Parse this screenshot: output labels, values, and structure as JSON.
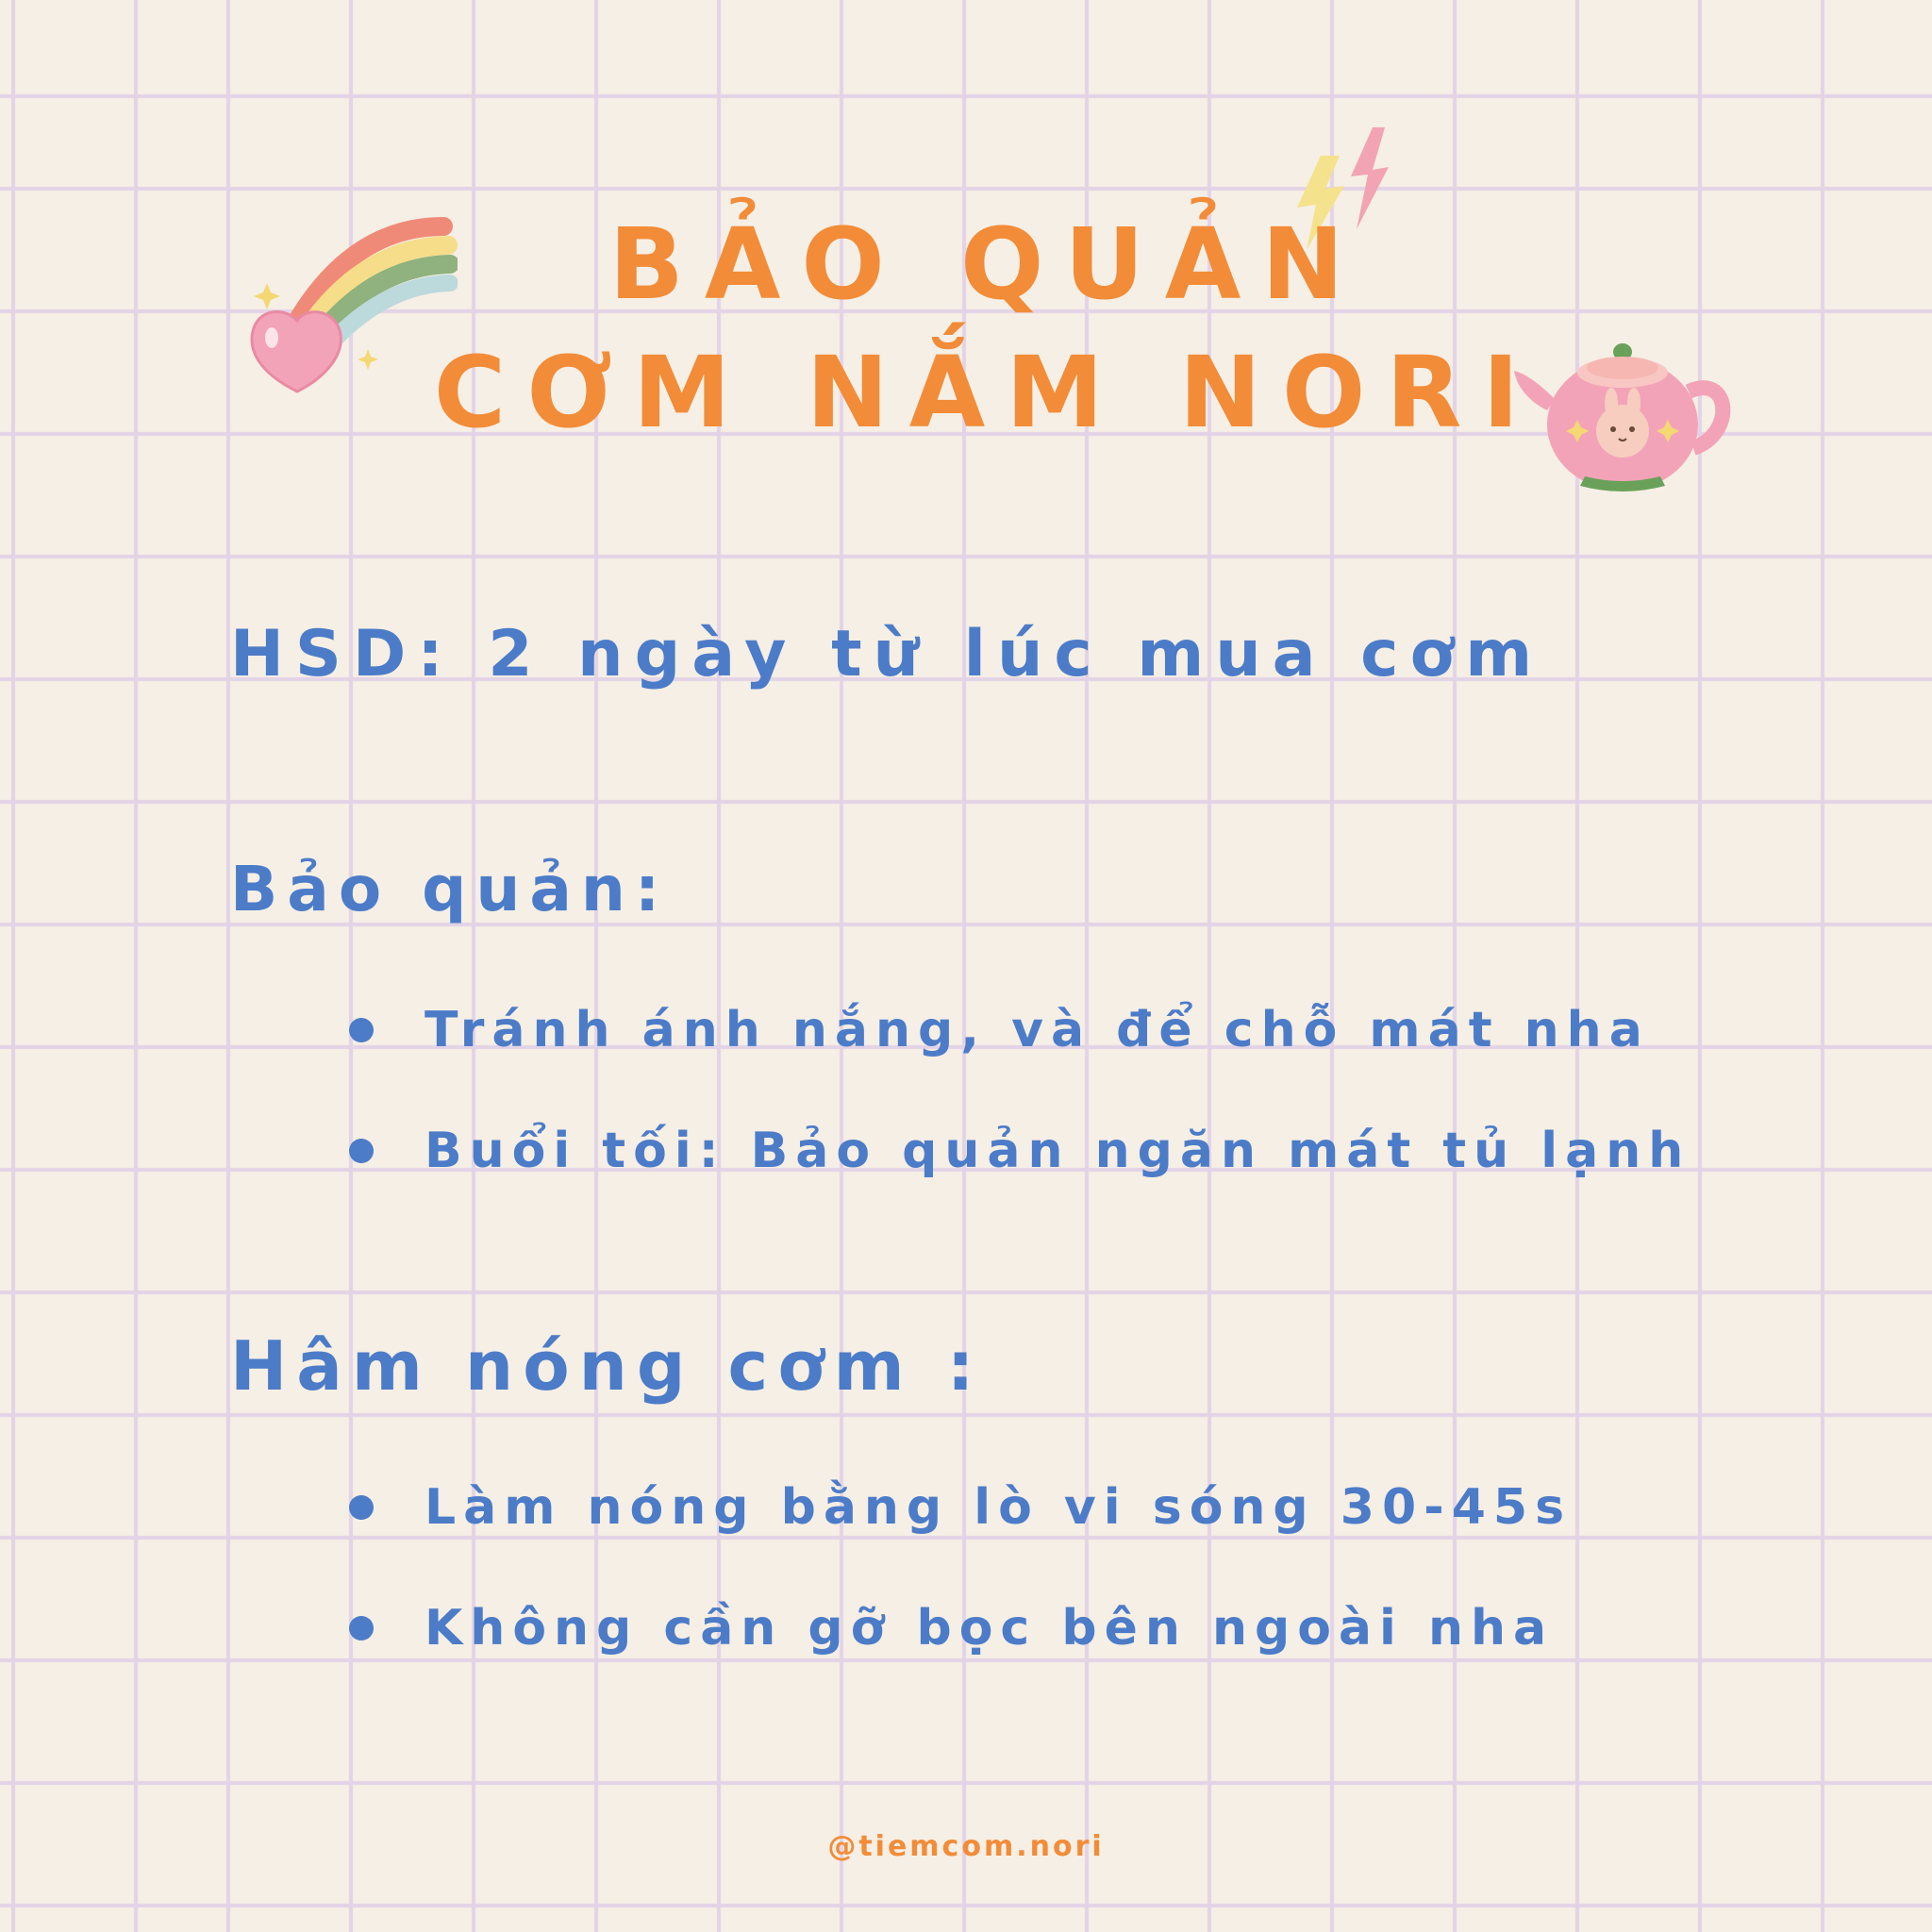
{
  "title": {
    "line1": "BẢO QUẢN",
    "line2": "CƠM NẮM NORI"
  },
  "hsd": "HSD: 2 ngày từ lúc mua cơm",
  "storage": {
    "heading": "Bảo quản:",
    "items": [
      "Tránh ánh nắng, và để chỗ mát nha",
      "Buổi tối: Bảo quản ngăn mát tủ lạnh"
    ]
  },
  "reheat": {
    "heading": "Hâm nóng cơm :",
    "items": [
      "Làm nóng bằng lò vi sóng 30-45s",
      "Không cần gỡ bọc bên ngoài nha"
    ]
  },
  "handle": "@tiemcom.nori",
  "colors": {
    "background": "#f6efe5",
    "grid": "#e2d3e6",
    "title": "#f28c38",
    "body_text": "#4c7cc8"
  },
  "decorations": [
    "rainbow-heart-icon",
    "lightning-icon",
    "teapot-bunny-icon"
  ]
}
